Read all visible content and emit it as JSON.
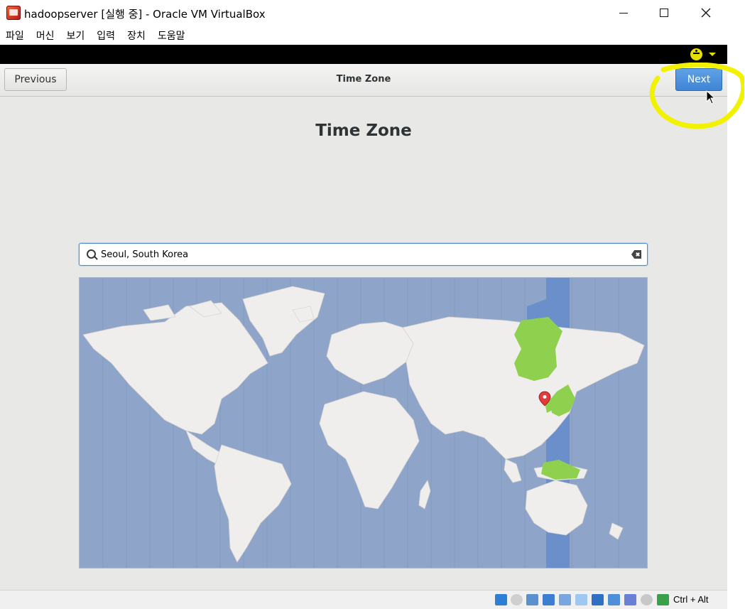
{
  "window": {
    "title": "hadoopserver [실행 중] - Oracle VM VirtualBox",
    "menu": [
      "파일",
      "머신",
      "보기",
      "입력",
      "장치",
      "도움말"
    ]
  },
  "installer": {
    "header_title": "Time Zone",
    "previous_label": "Previous",
    "next_label": "Next",
    "page_title": "Time Zone",
    "search_value": "Seoul, South Korea",
    "selected_marker": "location-pin-icon"
  },
  "statusbar": {
    "host_key": "Ctrl + Alt",
    "icons": [
      "hard-disk-icon",
      "optical-drive-icon",
      "audio-icon",
      "network-icon",
      "usb-icon",
      "shared-folders-icon",
      "display-icon",
      "video-capture-icon",
      "cpu-icon",
      "mouse-integration-icon",
      "host-key-icon"
    ]
  },
  "colors": {
    "accent": "#4a90d9",
    "map_ocean": "#8ea5c9",
    "map_land": "#f0eeec",
    "highlight_zone": "#6a8fcb",
    "highlight_land": "#8fd14f",
    "annotation": "#f2f200"
  }
}
